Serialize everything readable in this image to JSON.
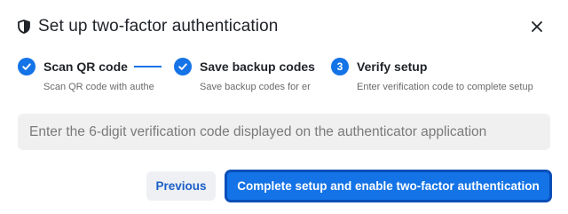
{
  "dialog": {
    "title": "Set up two-factor authentication",
    "title_icon": "shield-icon",
    "close_icon": "close-icon"
  },
  "steps": [
    {
      "number": "1",
      "status": "completed",
      "title": "Scan QR code",
      "description": "Scan QR code with authe"
    },
    {
      "number": "2",
      "status": "completed",
      "title": "Save backup codes",
      "description": "Save backup codes for er"
    },
    {
      "number": "3",
      "status": "current",
      "title": "Verify setup",
      "description": "Enter verification code to complete setup"
    }
  ],
  "verification": {
    "value": "",
    "placeholder": "Enter the 6-digit verification code displayed on the authenticator application"
  },
  "actions": {
    "previous_label": "Previous",
    "primary_label": "Complete setup and enable two-factor authentication"
  },
  "colors": {
    "accent": "#1473e6",
    "field_bg": "#f0f0f0",
    "secondary_button_bg": "#eef0f3"
  }
}
